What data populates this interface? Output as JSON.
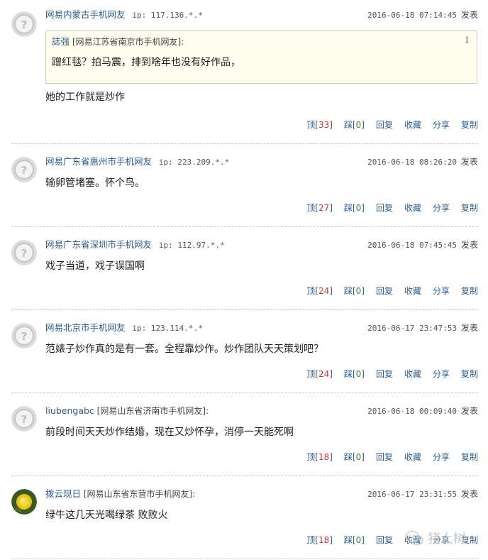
{
  "labels": {
    "post": "发表",
    "ip_prefix": "ip:"
  },
  "actions": {
    "up": "顶",
    "down": "踩",
    "reply": "回复",
    "fav": "收藏",
    "share": "分享",
    "copy": "复制"
  },
  "comments": [
    {
      "user": "网易内蒙古手机网友",
      "ip": "117.136.*.*",
      "time": "2016-06-18 07:14:45",
      "quote": {
        "user": "誌强",
        "loc": "[网易江苏省南京市手机网友]:",
        "num": "1",
        "text": "蹭红毯？拍马震，排到啥年也没有好作品，"
      },
      "text": "她的工作就是炒作",
      "up": "33",
      "down": "0"
    },
    {
      "user": "网易广东省惠州市手机网友",
      "ip": "223.209.*.*",
      "time": "2016-06-18 08:26:20",
      "text": "输卵管堵塞。怀个鸟。",
      "up": "27",
      "down": "0"
    },
    {
      "user": "网易广东省深圳市手机网友",
      "ip": "112.97.*.*",
      "time": "2016-06-18 07:45:45",
      "text": "戏子当道，戏子误国啊",
      "up": "24",
      "down": "0"
    },
    {
      "user": "网易北京市手机网友",
      "ip": "123.114.*.*",
      "time": "2016-06-17 23:47:53",
      "text": "范婊子炒作真的是有一套。全程靠炒作。炒作团队天天策划吧？",
      "up": "24",
      "down": "0"
    },
    {
      "user": "liubengabc",
      "loc": "[网易山东省济南市手机网友]:",
      "time": "2016-06-18 00:09:40",
      "text": "前段时间天天炒作结婚，现在又炒怀孕，消停一天能死啊",
      "up": "18",
      "down": "0"
    },
    {
      "user": "拨云现日",
      "loc": "[网易山东省东营市手机网友]:",
      "time": "2016-06-17 23:31:55",
      "text": "绿牛这几天光喝绿茶 败败火",
      "up": "18",
      "down": "0"
    }
  ],
  "watermark": "猪上树",
  "colors": {
    "link": "#2b5c8a",
    "up_count": "#c0392b",
    "down_count": "#2e8b2e",
    "quote_bg": "#fefdee"
  }
}
